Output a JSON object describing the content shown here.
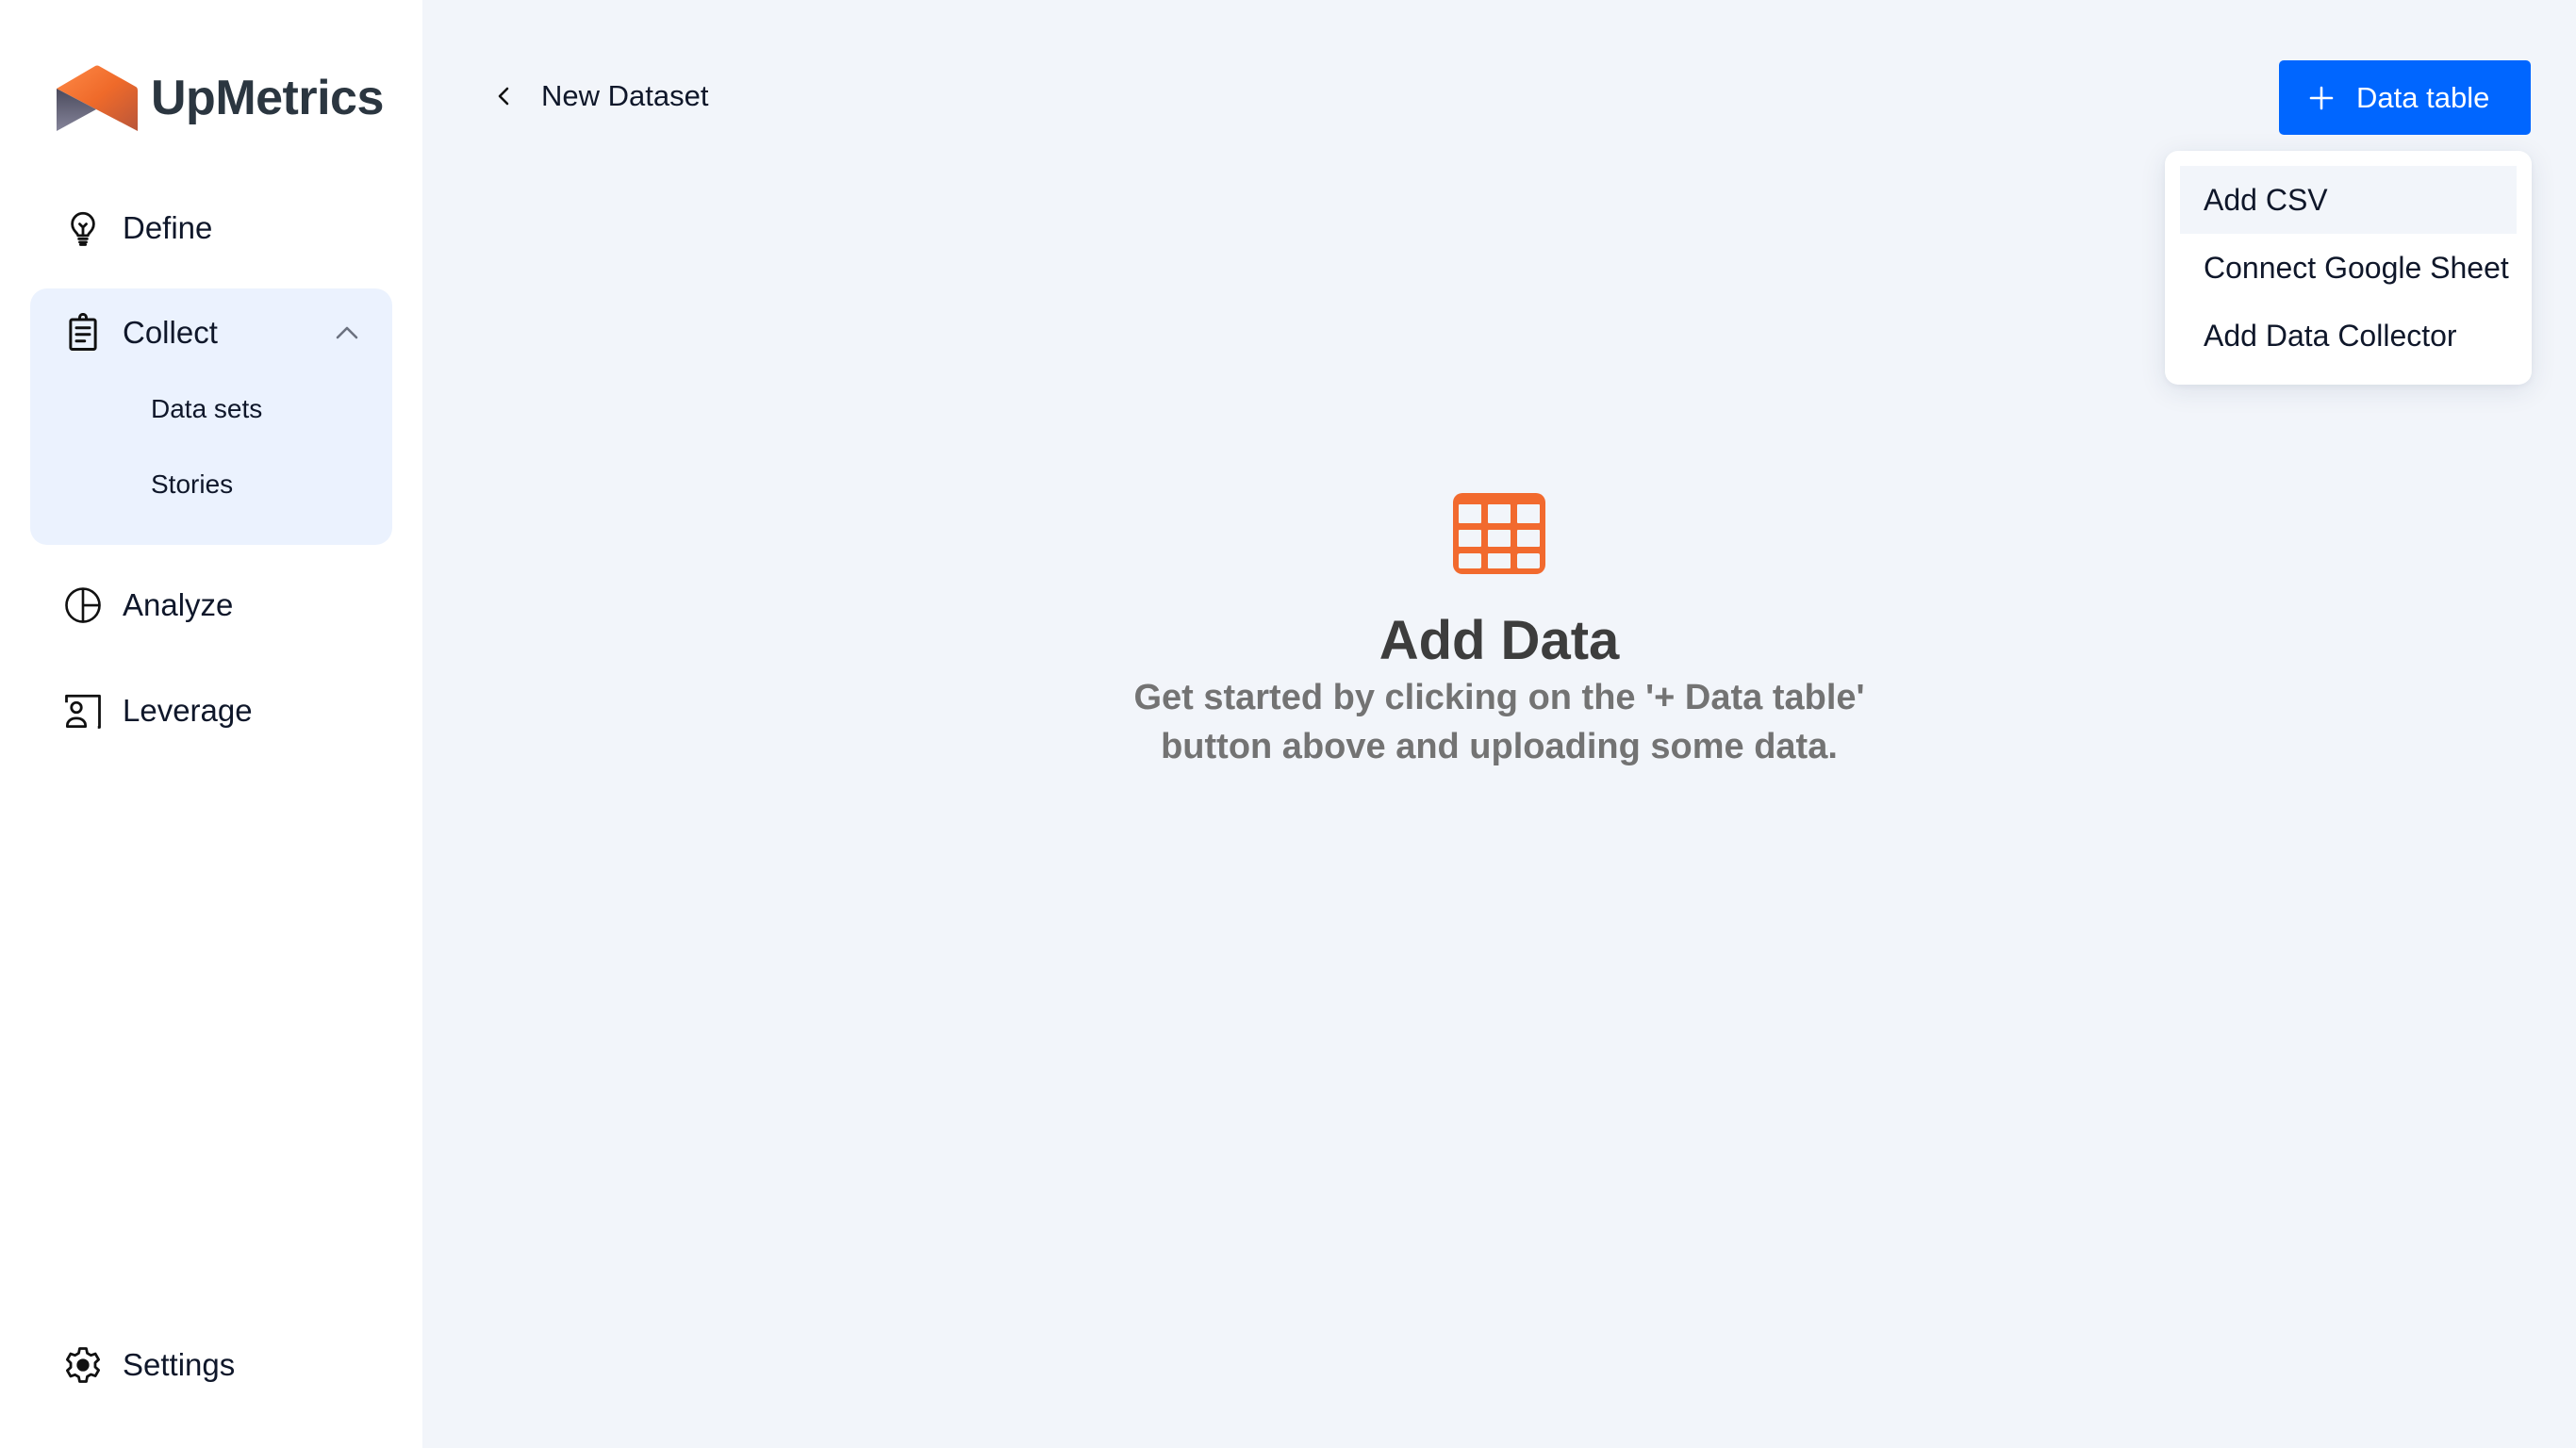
{
  "app": {
    "brand_name": "UpMetrics",
    "colors": {
      "accent": "#0066ff",
      "brand_orange": "#f26a2e",
      "sidebar_active_bg": "#ebf2fe",
      "main_bg": "#f2f5fa"
    }
  },
  "sidebar": {
    "items": [
      {
        "label": "Define",
        "icon": "lightbulb-icon"
      },
      {
        "label": "Collect",
        "icon": "clipboard-icon",
        "expanded": true,
        "children": [
          {
            "label": "Data sets"
          },
          {
            "label": "Stories"
          }
        ]
      },
      {
        "label": "Analyze",
        "icon": "pie-chart-icon"
      },
      {
        "label": "Leverage",
        "icon": "user-card-icon"
      }
    ],
    "settings": {
      "label": "Settings",
      "icon": "gear-icon"
    }
  },
  "header": {
    "back_icon": "chevron-left-icon",
    "title": "New Dataset",
    "primary_button": {
      "label": "Data table",
      "icon": "plus-icon"
    }
  },
  "dropdown": {
    "items": [
      {
        "label": "Add CSV",
        "highlighted": true
      },
      {
        "label": "Connect Google Sheet"
      },
      {
        "label": "Add Data Collector"
      }
    ]
  },
  "empty_state": {
    "icon": "table-icon",
    "title": "Add Data",
    "description_line1": "Get started by clicking on the '+ Data table'",
    "description_line2": "button above and uploading some data."
  }
}
